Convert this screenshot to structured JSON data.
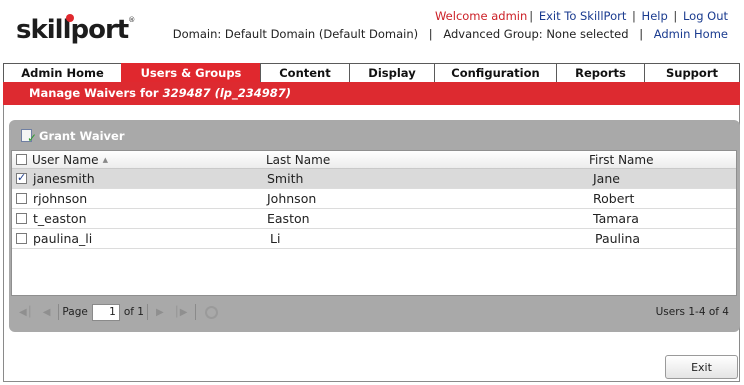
{
  "logo": {
    "text": "skillport",
    "tm": "®"
  },
  "header": {
    "welcome": "Welcome admin",
    "exit_link": "Exit To SkillPort",
    "help_link": "Help",
    "logout_link": "Log Out",
    "sep": "|",
    "domain_text": "Domain: Default Domain (Default Domain)",
    "advanced_group_text": "Advanced Group: None selected",
    "admin_home_link": "Admin Home"
  },
  "tabs": [
    {
      "label": "Admin Home",
      "active": false
    },
    {
      "label": "Users & Groups",
      "active": true
    },
    {
      "label": "Content",
      "active": false
    },
    {
      "label": "Display",
      "active": false
    },
    {
      "label": "Configuration",
      "active": false
    },
    {
      "label": "Reports",
      "active": false
    },
    {
      "label": "Support",
      "active": false
    }
  ],
  "page_title": {
    "prefix": "Manage Waivers for",
    "subject": "329487 (lp_234987)"
  },
  "toolbar": {
    "grant_waiver": "Grant Waiver"
  },
  "grid": {
    "columns": {
      "user_name": "User Name",
      "last_name": "Last Name",
      "first_name": "First Name"
    },
    "sort_indicator": "▲",
    "rows": [
      {
        "user_name": "janesmith",
        "last_name": "Smith",
        "first_name": "Jane",
        "checked": true
      },
      {
        "user_name": "rjohnson",
        "last_name": "Johnson",
        "first_name": "Robert",
        "checked": false
      },
      {
        "user_name": "t_easton",
        "last_name": "Easton",
        "first_name": "Tamara",
        "checked": false
      },
      {
        "user_name": "paulina_li",
        "last_name": "Li",
        "first_name": "Paulina",
        "checked": false
      }
    ]
  },
  "pager": {
    "page_label": "Page",
    "page_value": "1",
    "of_label": "of 1",
    "status": "Users 1-4 of 4"
  },
  "exit_button": "Exit",
  "colors": {
    "accent_red": "#e0282e",
    "link_blue": "#1a3b8f",
    "panel_gray": "#a9a9a9"
  }
}
